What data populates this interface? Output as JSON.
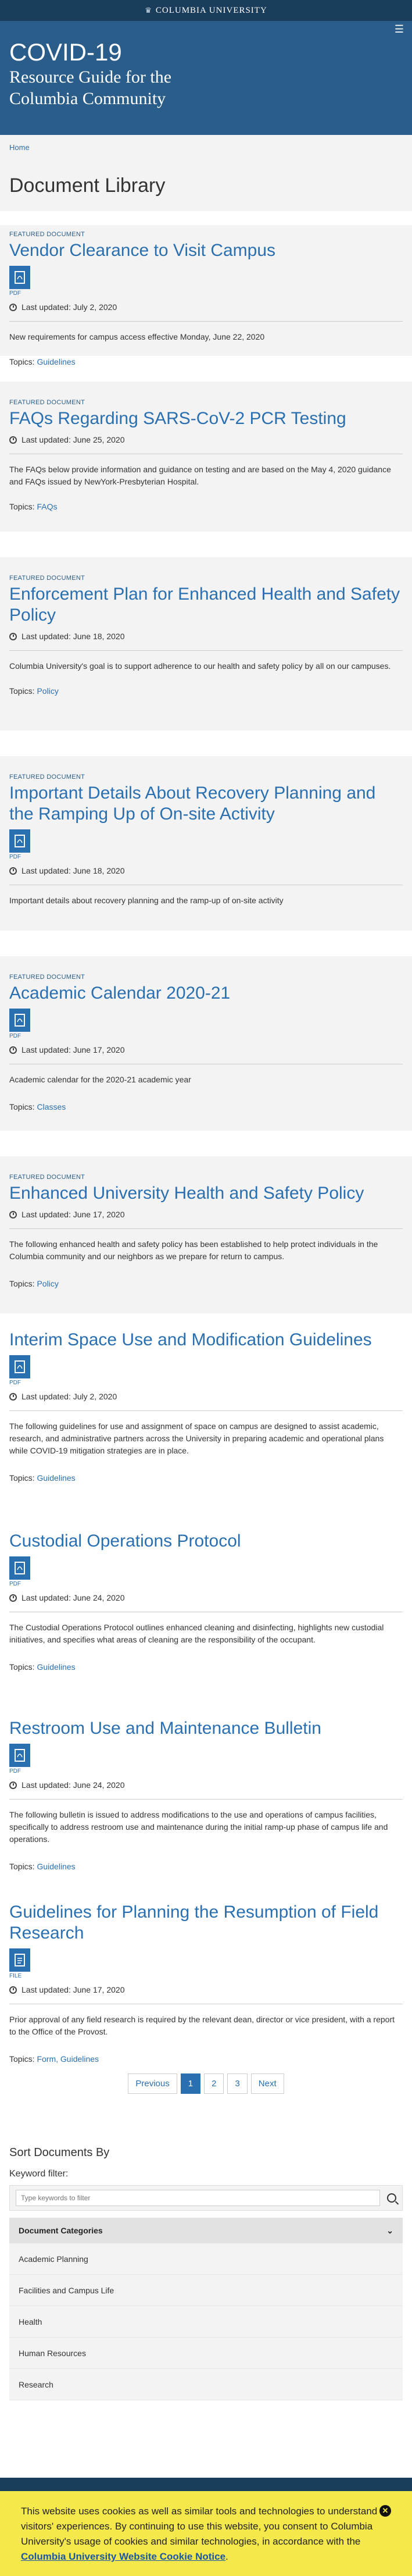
{
  "topbar": {
    "brand": "Columbia University",
    "crown": "♛"
  },
  "header": {
    "title": "COVID-19",
    "subtitle_line1": "Resource Guide for the",
    "subtitle_line2": "Columbia Community",
    "menu_icon": "☰"
  },
  "breadcrumb": {
    "home": "Home"
  },
  "library": {
    "title": "Document Library"
  },
  "labels": {
    "featured": "FEATURED DOCUMENT",
    "topics": "Topics:",
    "pdf": "PDF",
    "file": "FILE"
  },
  "documents": [
    {
      "title": "Vendor Clearance to Visit Campus",
      "icon": "pdf",
      "updated": "Last updated: July 2, 2020",
      "desc": "New requirements for campus access effective Monday, June 22, 2020",
      "topics": "Guidelines"
    },
    {
      "title": "FAQs Regarding SARS-CoV-2 PCR Testing",
      "updated": "Last updated: June 25, 2020",
      "desc": "The FAQs below provide information and guidance on testing and are based on the May 4, 2020 guidance and FAQs issued by NewYork-Presbyterian Hospital.",
      "topics": "FAQs"
    },
    {
      "title": "Enforcement Plan for Enhanced Health and Safety Policy",
      "updated": "Last updated: June 18, 2020",
      "desc": "Columbia University's goal is to support adherence to our health and safety policy by all on our campuses.",
      "topics": "Policy"
    },
    {
      "title": "Important Details About Recovery Planning and the Ramping Up of On-site Activity",
      "icon": "pdf",
      "updated": "Last updated: June 18, 2020",
      "desc": "Important details about recovery planning and the ramp-up of on-site activity"
    },
    {
      "title": "Academic Calendar 2020-21",
      "icon": "pdf",
      "updated": "Last updated: June 17, 2020",
      "desc": "Academic calendar for the 2020-21 academic year",
      "topics": "Classes"
    },
    {
      "title": "Enhanced University Health and Safety Policy",
      "updated": "Last updated: June 17, 2020",
      "desc": "The following enhanced health and safety policy has been established to help protect individuals in the Columbia community and our neighbors as we prepare for return to campus.",
      "topics": "Policy"
    },
    {
      "title": "Interim Space Use and Modification Guidelines",
      "icon": "pdf",
      "updated": "Last updated: July 2, 2020",
      "desc": "The following guidelines for use and assignment of space on campus are designed to assist academic, research, and administrative partners across the University in preparing academic and operational plans while COVID-19 mitigation strategies are in place.",
      "topics": "Guidelines"
    },
    {
      "title": "Custodial Operations Protocol",
      "icon": "pdf",
      "updated": "Last updated: June 24, 2020",
      "desc": "The Custodial Operations Protocol outlines enhanced cleaning and disinfecting, highlights new custodial initiatives, and specifies what areas of cleaning are the responsibility of the occupant.",
      "topics": "Guidelines"
    },
    {
      "title": "Restroom Use and Maintenance Bulletin",
      "icon": "pdf",
      "updated": "Last updated: June 24, 2020",
      "desc": "The following bulletin is issued to address modifications to the use and operations of campus facilities, specifically to address restroom use and maintenance during the initial ramp-up phase of campus life and operations.",
      "topics": "Guidelines"
    },
    {
      "title": "Guidelines for Planning the Resumption of Field Research",
      "icon": "file",
      "updated": "Last updated: June 17, 2020",
      "desc": "Prior approval of any field research is required by the relevant dean, director or vice president, with a report to the Office of the Provost.",
      "topics": "Form, Guidelines"
    }
  ],
  "pager": {
    "prev": "Previous",
    "p1": "1",
    "p2": "2",
    "p3": "3",
    "next": "Next"
  },
  "sort": {
    "title": "Sort Documents By",
    "keyword_label": "Keyword filter:",
    "placeholder": "Type keywords to filter",
    "categories_label": "Document Categories",
    "categories": [
      "Academic Planning",
      "Facilities and Campus Life",
      "Health",
      "Human Resources",
      "Research"
    ]
  },
  "cookie": {
    "text": "This website uses cookies as well as similar tools and technologies to understand visitors' experiences. By continuing to use this website, you consent to Columbia University's usage of cookies and similar technologies, in accordance with the ",
    "link": "Columbia University Website Cookie Notice",
    "period": ".",
    "close": "✕"
  },
  "colors": {
    "brand_dark": "#1a3d5c",
    "brand": "#2a5d89",
    "link": "#2a6fb0",
    "cookie_bg": "#f5e84a"
  }
}
